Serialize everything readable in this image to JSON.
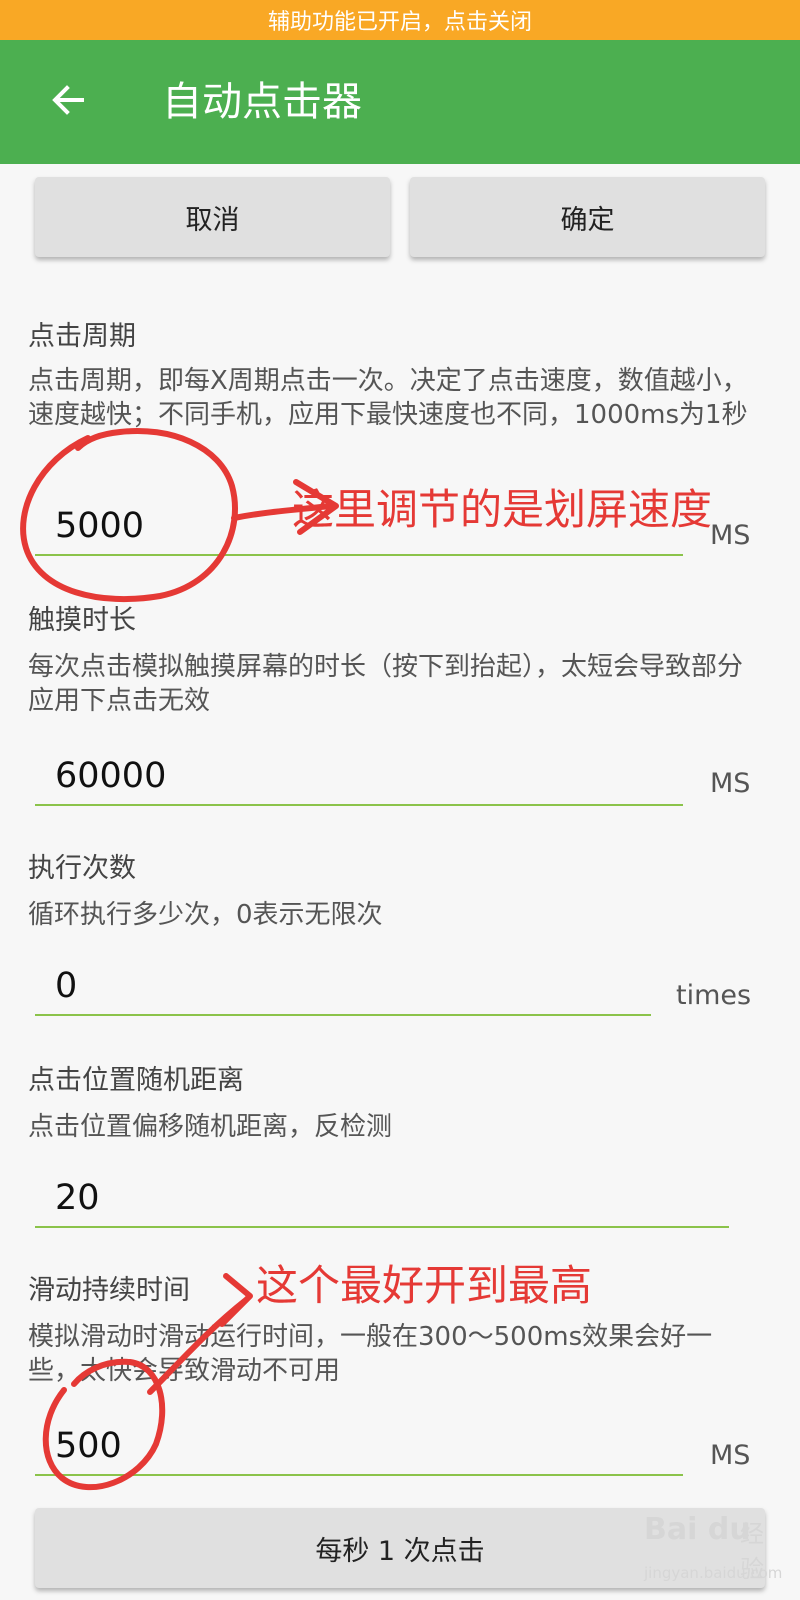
{
  "status_banner": "辅助功能已开启，点击关闭",
  "app_bar": {
    "title": "自动点击器",
    "back_icon": "arrow-left-icon"
  },
  "actions": {
    "cancel_label": "取消",
    "confirm_label": "确定"
  },
  "sections": [
    {
      "title": "点击周期",
      "description": "点击周期，即每X周期点击一次。决定了点击速度，数值越小，速度越快；不同手机，应用下最快速度也不同，1000ms为1秒",
      "value": "5000",
      "unit": "MS"
    },
    {
      "title": "触摸时长",
      "description": "每次点击模拟触摸屏幕的时长（按下到抬起），太短会导致部分应用下点击无效",
      "value": "60000",
      "unit": "MS"
    },
    {
      "title": "执行次数",
      "description": "循环执行多少次，0表示无限次",
      "value": "0",
      "unit": "times"
    },
    {
      "title": "点击位置随机距离",
      "description": "点击位置偏移随机距离，反检测",
      "value": "20",
      "unit": ""
    },
    {
      "title": "滑动持续时间",
      "description": "模拟滑动时滑动运行时间，一般在300～500ms效果会好一些，太快会导致滑动不可用",
      "value": "500",
      "unit": "MS"
    }
  ],
  "rate_button_label": "每秒 1 次点击",
  "annotations": {
    "note_1": "这里调节的是划屏速度",
    "note_2": "这个最好开到最高",
    "color": "#e53935"
  },
  "watermark": {
    "logo": "Bai du",
    "brand": "经验",
    "url": "jingyan.baidu.com"
  },
  "colors": {
    "banner": "#f9a825",
    "app_bar": "#4caf50",
    "field_underline": "#8bc34a"
  }
}
